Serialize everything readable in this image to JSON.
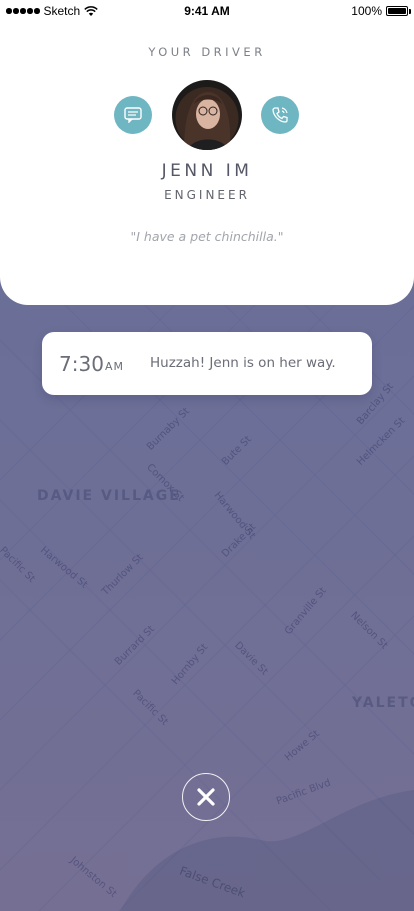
{
  "status_bar": {
    "carrier": "Sketch",
    "time": "9:41 AM",
    "battery": "100%"
  },
  "driver_card": {
    "heading": "YOUR DRIVER",
    "name": "JENN IM",
    "role": "ENGINEER",
    "quote": "\"I have a pet chinchilla.\"",
    "message_icon": "chat-bubble-icon",
    "call_icon": "phone-icon",
    "accent_color": "#6fb6c3"
  },
  "eta": {
    "time": "7:30",
    "ampm": "AM",
    "message": "Huzzah! Jenn is on her way."
  },
  "map": {
    "districts": [
      "DAVIE VILLAGE",
      "YALETO"
    ],
    "water": "False Creek",
    "streets": [
      "Burnaby St",
      "Bute St",
      "Comox St",
      "Harwood St",
      "Thurlow St",
      "Pacific St",
      "Burrard St",
      "Hornby St",
      "Davie St",
      "Drake St",
      "Nelson St",
      "Granville St",
      "Helmcken St",
      "Howe St",
      "Pacific Blvd",
      "Johnston St",
      "Barclay St",
      "Harwood St",
      "Pacific St"
    ]
  },
  "close_icon": "close-icon"
}
